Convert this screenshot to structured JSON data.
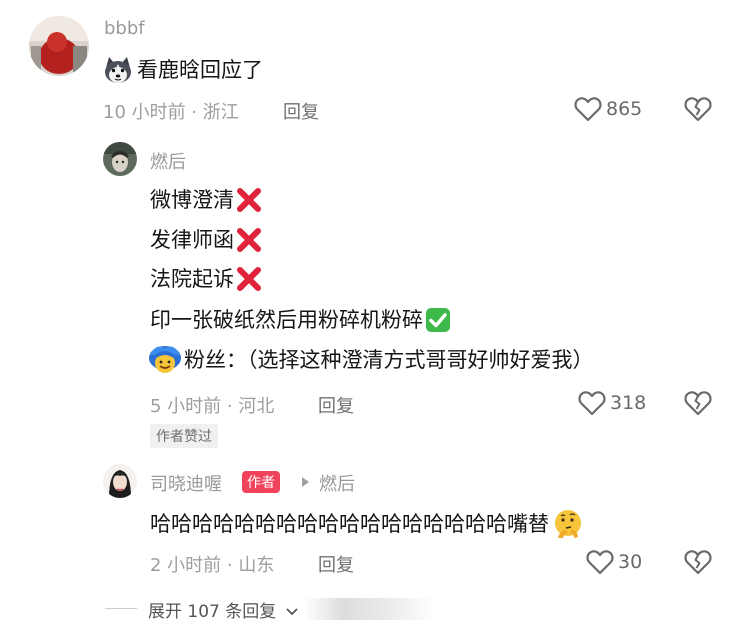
{
  "comment1": {
    "username": "bbbf",
    "text": "看鹿晗回应了",
    "emoji_icon": "husky-dog-emoji",
    "meta": "10 小时前 · 浙江",
    "reply_label": "回复",
    "likes": "865"
  },
  "comment2": {
    "username": "燃后",
    "lines": [
      "微博澄清",
      "发律师函",
      "法院起诉",
      "印一张破纸然后用粉碎机粉碎"
    ],
    "line_icons": [
      "cross-mark-icon",
      "cross-mark-icon",
      "cross-mark-icon",
      "check-mark-icon"
    ],
    "fan_text": "粉丝：（选择这种澄清方式哥哥好帅好爱我）",
    "fan_icon": "blue-hair-smiling-face-emoji",
    "meta": "5 小时前 · 河北",
    "reply_label": "回复",
    "likes": "318",
    "badge": "作者赞过"
  },
  "comment3": {
    "username": "司晓迪喔",
    "author_tag": "作者",
    "reply_to": "燃后",
    "text": "哈哈哈哈哈哈哈哈哈哈哈哈哈哈哈哈哈嘴替",
    "emoji_icon": "thinking-face-emoji",
    "meta": "2 小时前 · 山东",
    "reply_label": "回复",
    "likes": "30"
  },
  "expand": {
    "label": "展开 107 条回复"
  },
  "colors": {
    "author_tag_bg": "#f0425a",
    "cross_red": "#e0233a",
    "check_green": "#3cb94a"
  }
}
